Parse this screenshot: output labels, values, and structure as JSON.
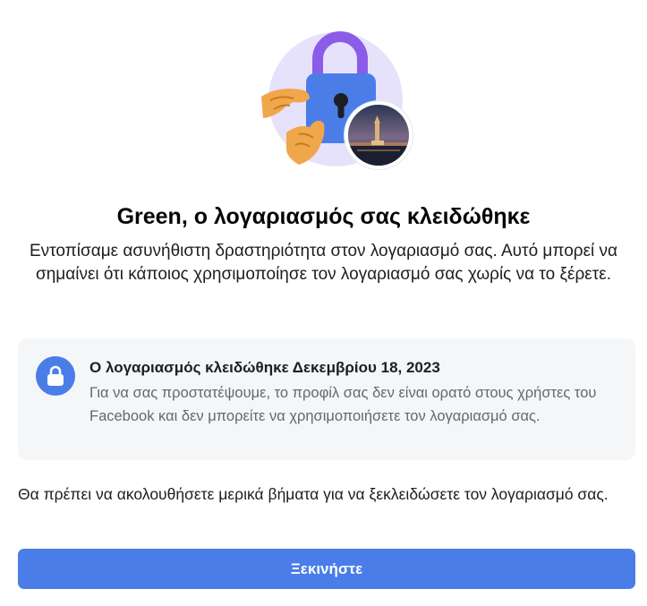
{
  "hero": {
    "illustration_icon": "padlock-hands-icon",
    "avatar_icon": "profile-photo-icon"
  },
  "header": {
    "title": "Green, ο λογαριασμός σας κλειδώθηκε",
    "subtitle": "Εντοπίσαμε ασυνήθιστη δραστηριότητα στον λογαριασμό σας. Αυτό μπορεί να σημαίνει ότι κάποιος χρησιμοποίησε τον λογαριασμό σας χωρίς να το ξέρετε."
  },
  "notice": {
    "icon": "lock-icon",
    "heading": "Ο λογαριασμός κλειδώθηκε Δεκεμβρίου 18, 2023",
    "body": "Για να σας προστατέψουμε, το προφίλ σας δεν είναι ορατό στους χρήστες του Facebook και δεν μπορείτε να χρησιμοποιήσετε τον λογαριασμό σας."
  },
  "instruction": "Θα πρέπει να ακολουθήσετε μερικά βήματα για να ξεκλειδώσετε τον λογαριασμό σας.",
  "actions": {
    "start_label": "Ξεκινήστε"
  },
  "colors": {
    "accent": "#4a7de8",
    "notice_bg": "#f5f6f7",
    "muted_text": "#65676b"
  }
}
